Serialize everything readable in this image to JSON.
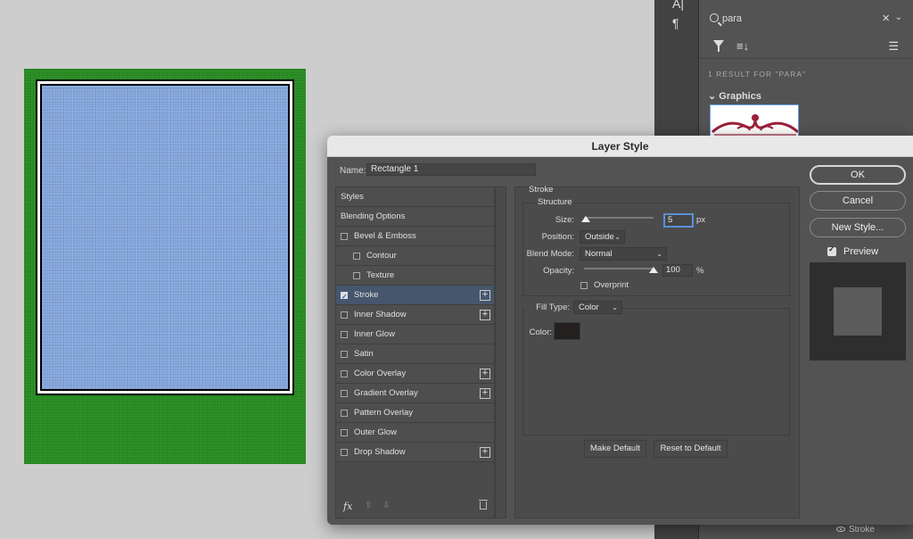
{
  "toolstrip": {
    "character_glyph": "A|",
    "paragraph_glyph": "¶"
  },
  "library": {
    "search_value": "para",
    "result_count": "1 RESULT FOR \"PARA\"",
    "section_heading": "Graphics",
    "bottom_layer_effect": "Stroke"
  },
  "dialog": {
    "title": "Layer Style",
    "name_label": "Name:",
    "name_value": "Rectangle 1",
    "styles": [
      {
        "label": "Styles",
        "checkbox": false,
        "plus": false
      },
      {
        "label": "Blending Options",
        "checkbox": false,
        "plus": false
      },
      {
        "label": "Bevel & Emboss",
        "checkbox": true,
        "checked": false,
        "plus": false
      },
      {
        "label": "Contour",
        "checkbox": true,
        "checked": false,
        "plus": false,
        "indent": true
      },
      {
        "label": "Texture",
        "checkbox": true,
        "checked": false,
        "plus": false,
        "indent": true
      },
      {
        "label": "Stroke",
        "checkbox": true,
        "checked": true,
        "plus": true,
        "selected": true
      },
      {
        "label": "Inner Shadow",
        "checkbox": true,
        "checked": false,
        "plus": true
      },
      {
        "label": "Inner Glow",
        "checkbox": true,
        "checked": false,
        "plus": false
      },
      {
        "label": "Satin",
        "checkbox": true,
        "checked": false,
        "plus": false
      },
      {
        "label": "Color Overlay",
        "checkbox": true,
        "checked": false,
        "plus": true
      },
      {
        "label": "Gradient Overlay",
        "checkbox": true,
        "checked": false,
        "plus": true
      },
      {
        "label": "Pattern Overlay",
        "checkbox": true,
        "checked": false,
        "plus": false
      },
      {
        "label": "Outer Glow",
        "checkbox": true,
        "checked": false,
        "plus": false
      },
      {
        "label": "Drop Shadow",
        "checkbox": true,
        "checked": false,
        "plus": true
      }
    ],
    "footer": {
      "fx": "fx",
      "up": "⇧",
      "down": "⇩"
    },
    "stroke": {
      "section_title": "Stroke",
      "structure_title": "Structure",
      "size_label": "Size:",
      "size_value": "5",
      "size_unit": "px",
      "position_label": "Position:",
      "position_value": "Outside",
      "blend_label": "Blend Mode:",
      "blend_value": "Normal",
      "opacity_label": "Opacity:",
      "opacity_value": "100",
      "opacity_unit": "%",
      "opacity_level": 1.0,
      "size_level": 0.02,
      "overprint_label": "Overprint",
      "fill_type_label": "Fill Type:",
      "fill_type_value": "Color",
      "color_label": "Color:",
      "color_value": "#252020"
    },
    "make_default": "Make Default",
    "reset_default": "Reset to Default",
    "buttons": {
      "ok": "OK",
      "cancel": "Cancel",
      "new_style": "New Style...",
      "preview_label": "Preview"
    }
  },
  "colors": {
    "artboard_green": "#2b8f25",
    "rect_fill": "#7fa2d8",
    "accent_blue": "#5c8fd6"
  }
}
